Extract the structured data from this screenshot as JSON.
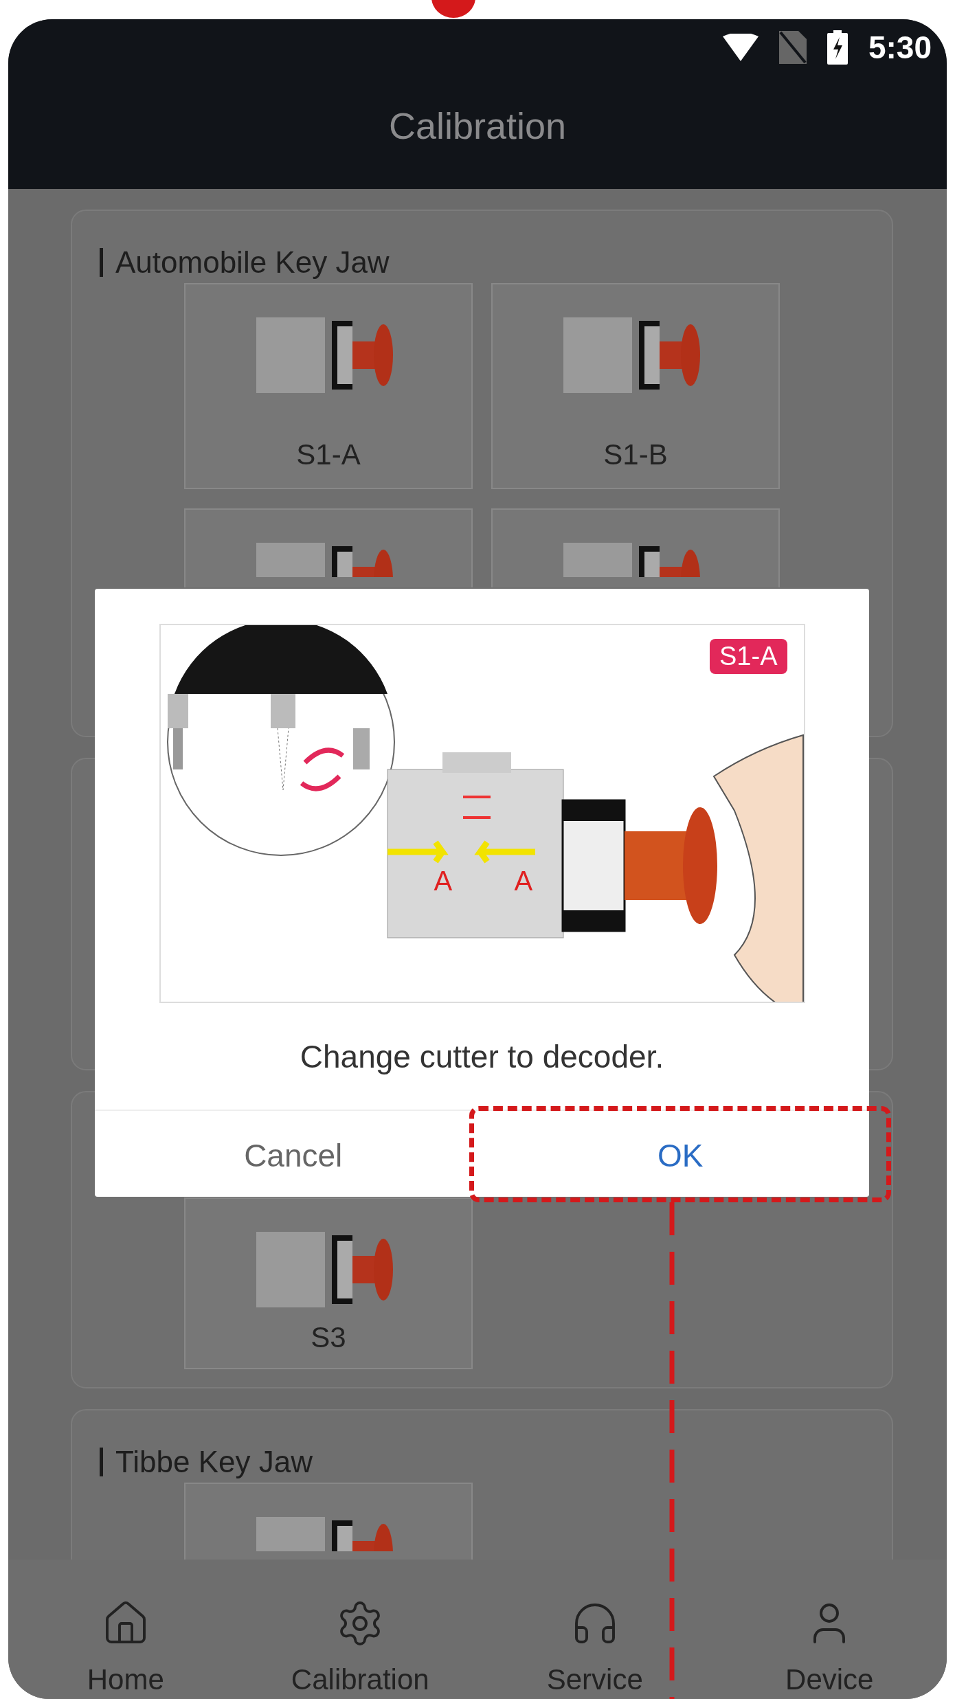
{
  "status_bar": {
    "time": "5:30"
  },
  "header": {
    "title": "Calibration"
  },
  "sections": [
    {
      "kind": "titled",
      "title": "Automobile Key Jaw",
      "tiles": [
        {
          "kind": "labeled",
          "label": "S1-A"
        },
        {
          "kind": "labeled",
          "label": "S1-B"
        },
        {
          "kind": "cut"
        },
        {
          "kind": "cut"
        }
      ]
    },
    {
      "kind": "covered"
    },
    {
      "kind": "covered",
      "tiles": [
        {
          "kind": "labeled",
          "label": "S3"
        }
      ]
    },
    {
      "kind": "titled",
      "title": "Tibbe Key Jaw",
      "tiles": [
        {
          "kind": "cut"
        }
      ]
    }
  ],
  "dialog": {
    "badge": "S1-A",
    "illustration_labels": [
      "A",
      "A"
    ],
    "message": "Change cutter to decoder.",
    "buttons": [
      {
        "kind": "cancel",
        "label": "Cancel"
      },
      {
        "kind": "confirm",
        "label": "OK"
      }
    ]
  },
  "nav": [
    {
      "label": "Home"
    },
    {
      "label": "Calibration"
    },
    {
      "label": "Service"
    },
    {
      "label": "Device"
    }
  ]
}
